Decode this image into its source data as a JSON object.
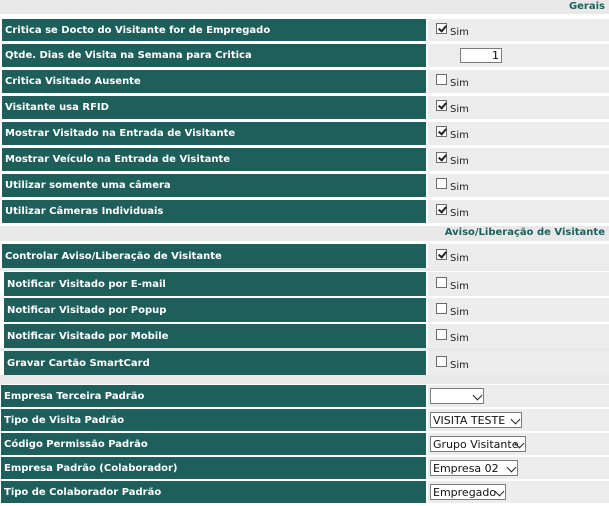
{
  "sections": {
    "gerais": "Gerais",
    "aviso": "Aviso/Liberação de Visitante"
  },
  "check_label": "Sim",
  "gerais_rows": [
    {
      "label": "Critica se Docto do Visitante for de Empregado",
      "checked": true
    },
    {
      "label": "Qtde. Dias de Visita na Semana para Critica",
      "value": "1"
    },
    {
      "label": "Critica Visitado Ausente",
      "checked": false
    },
    {
      "label": "Visitante usa RFID",
      "checked": true
    },
    {
      "label": "Mostrar Visitado na Entrada de Visitante",
      "checked": true
    },
    {
      "label": "Mostrar Veículo na Entrada de Visitante",
      "checked": true
    },
    {
      "label": "Utilizar somente uma câmera",
      "checked": false
    },
    {
      "label": "Utilizar Câmeras Individuais",
      "checked": true
    }
  ],
  "aviso_rows": [
    {
      "label": "Controlar Aviso/Liberação de Visitante",
      "checked": true
    },
    {
      "label": "Notificar Visitado por E-mail",
      "checked": false
    },
    {
      "label": "Notificar Visitado por Popup",
      "checked": false
    },
    {
      "label": "Notificar Visitado por Mobile",
      "checked": false
    },
    {
      "label": "Gravar Cartão SmartCard",
      "checked": false
    }
  ],
  "select_rows": [
    {
      "label": "Empresa Terceira Padrão",
      "selected": ""
    },
    {
      "label": "Tipo de Visita Padrão",
      "selected": "VISITA TESTE"
    },
    {
      "label": "Código Permissão Padrão",
      "selected": "Grupo Visitante"
    },
    {
      "label": "Empresa Padrão (Colaborador)",
      "selected": "Empresa 02"
    },
    {
      "label": "Tipo de Colaborador Padrão",
      "selected": "Empregado"
    }
  ]
}
